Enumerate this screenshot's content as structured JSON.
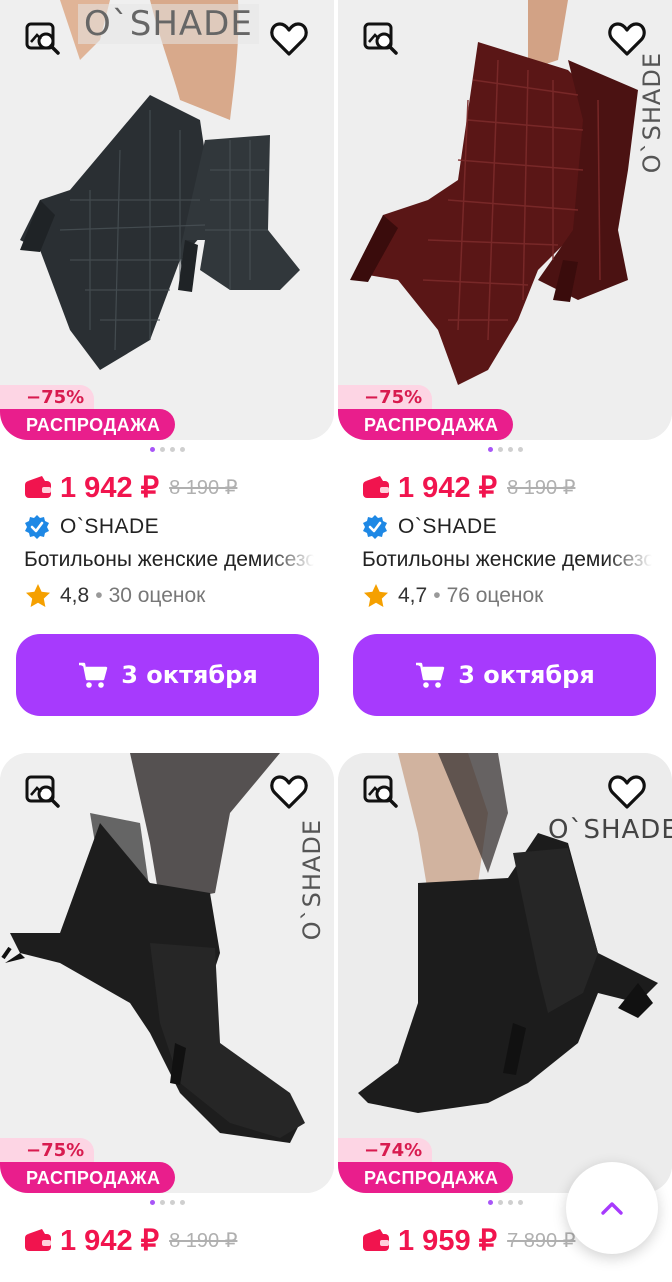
{
  "products": [
    {
      "brand_watermark": "O`SHADE",
      "discount": "−75%",
      "sale_label": "РАСПРОДАЖА",
      "price": "1 942 ₽",
      "old_price": "8 190 ₽",
      "brand": "O`SHADE",
      "title": "Ботильоны женские демисезонные",
      "rating": "4,8",
      "reviews": "30 оценок",
      "delivery": "3 октября"
    },
    {
      "brand_watermark": "O`SHADE",
      "discount": "−75%",
      "sale_label": "РАСПРОДАЖА",
      "price": "1 942 ₽",
      "old_price": "8 190 ₽",
      "brand": "O`SHADE",
      "title": "Ботильоны женские демисезонные",
      "rating": "4,7",
      "reviews": "76 оценок",
      "delivery": "3 октября"
    },
    {
      "brand_watermark": "O`SHADE",
      "discount": "−75%",
      "sale_label": "РАСПРОДАЖА",
      "price": "1 942 ₽",
      "old_price": "8 190 ₽"
    },
    {
      "brand_watermark": "O`SHADE",
      "discount": "−74%",
      "sale_label": "РАСПРОДАЖА",
      "price": "1 959 ₽",
      "old_price": "7 890 ₽"
    }
  ],
  "rating_separator": "•",
  "colors": {
    "accent_purple": "#a73afd",
    "price_red": "#f1144e",
    "sale_pink": "#e91e8c",
    "discount_bg": "#fdd5e4",
    "verified_blue": "#1e88e5",
    "star_orange": "#f5a000"
  },
  "icons": {
    "similar": "image-search-icon",
    "favorite": "heart-outline-icon",
    "wallet": "wallet-icon",
    "verified": "verified-badge-icon",
    "star": "star-icon",
    "cart": "cart-icon",
    "scroll_top": "chevron-up-icon"
  }
}
